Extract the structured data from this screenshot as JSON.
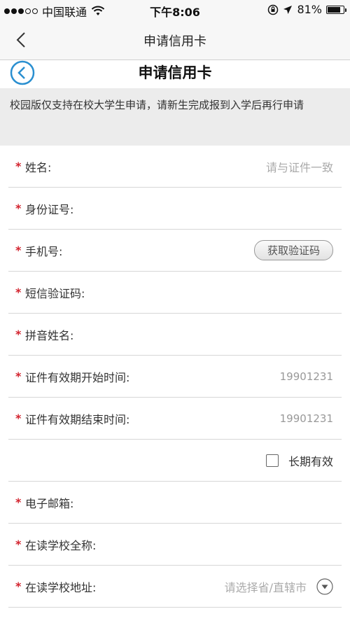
{
  "status_bar": {
    "carrier": "中国联通",
    "time": "下午8:06",
    "battery": "81%",
    "battery_level": 0.81,
    "icons": [
      "signal-dots",
      "wifi-icon",
      "rotation-lock-icon",
      "location-arrow-icon",
      "battery-icon"
    ]
  },
  "nav": {
    "title": "申请信用卡",
    "back_icon": "chevron-left-icon"
  },
  "header": {
    "title": "申请信用卡",
    "back_icon": "circle-back-icon"
  },
  "notice": "校园版仅支持在校大学生申请，请新生完成报到入学后再行申请",
  "form": {
    "required_mark": "*",
    "name": {
      "label": "姓名:",
      "placeholder": "请与证件一致"
    },
    "id_number": {
      "label": "身份证号:"
    },
    "phone": {
      "label": "手机号:",
      "button": "获取验证码"
    },
    "sms_code": {
      "label": "短信验证码:"
    },
    "pinyin": {
      "label": "拼音姓名:"
    },
    "valid_start": {
      "label": "证件有效期开始时间:",
      "hint": "19901231"
    },
    "valid_end": {
      "label": "证件有效期结束时间:",
      "hint": "19901231"
    },
    "long_term": {
      "label": "长期有效",
      "checked": false
    },
    "email": {
      "label": "电子邮箱:"
    },
    "school_name": {
      "label": "在读学校全称:"
    },
    "school_addr": {
      "label": "在读学校地址:",
      "placeholder": "请选择省/直辖市"
    }
  },
  "colors": {
    "required": "#d3232e",
    "accent": "#2a8fd0"
  }
}
